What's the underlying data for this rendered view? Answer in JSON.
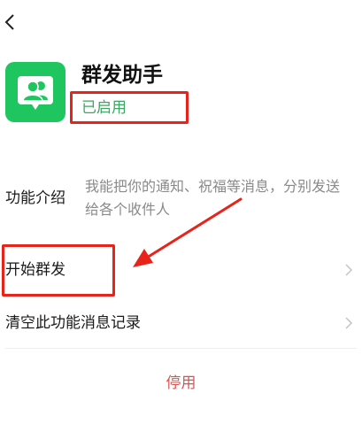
{
  "nav": {
    "back_icon": "chevron-left-icon"
  },
  "app": {
    "icon": "group-broadcast-icon",
    "icon_color": "#1fc65f",
    "title": "群发助手",
    "status": "已启用"
  },
  "intro": {
    "label": "功能介绍",
    "description": "我能把你的通知、祝福等消息，分别发送给各个收件人"
  },
  "rows": {
    "start_label": "开始群发",
    "clear_label": "清空此功能消息记录",
    "chevron_icon": "chevron-right-icon"
  },
  "actions": {
    "disable_label": "停用"
  },
  "annotations": {
    "highlight_color": "#e8231a",
    "arrow_color": "#e8231a"
  }
}
